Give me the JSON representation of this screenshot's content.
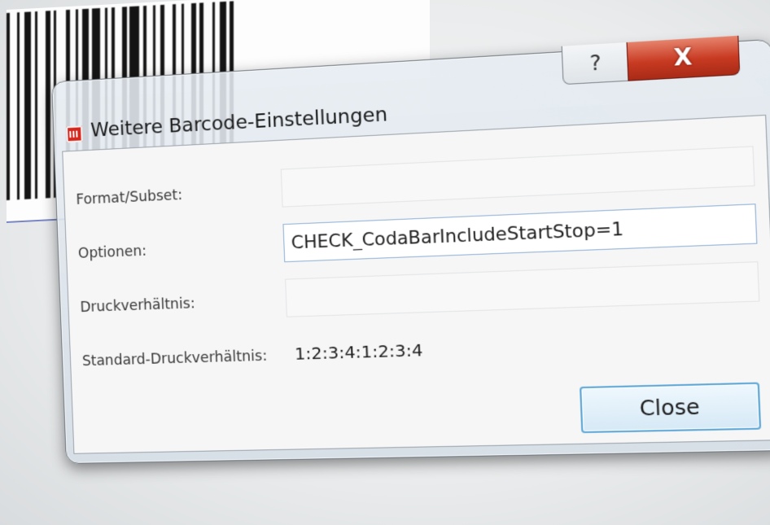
{
  "window": {
    "title": "Weitere Barcode-Einstellungen",
    "app_icon": "barcode-app-icon",
    "help_label": "?",
    "close_x_label": "X"
  },
  "form": {
    "format_subset": {
      "label": "Format/Subset:",
      "value": ""
    },
    "optionen": {
      "label": "Optionen:",
      "value": "CHECK_CodaBarIncludeStartStop=1"
    },
    "druckverhaeltnis": {
      "label": "Druckverhältnis:",
      "value": ""
    },
    "standard_druckverhaeltnis": {
      "label": "Standard-Druckverhältnis:",
      "value": "1:2:3:4:1:2:3:4"
    }
  },
  "footer": {
    "close_label": "Close"
  },
  "colors": {
    "close_x_button": "#c83a22",
    "focus_border": "#5fa8d6",
    "app_icon": "#d9261c"
  }
}
